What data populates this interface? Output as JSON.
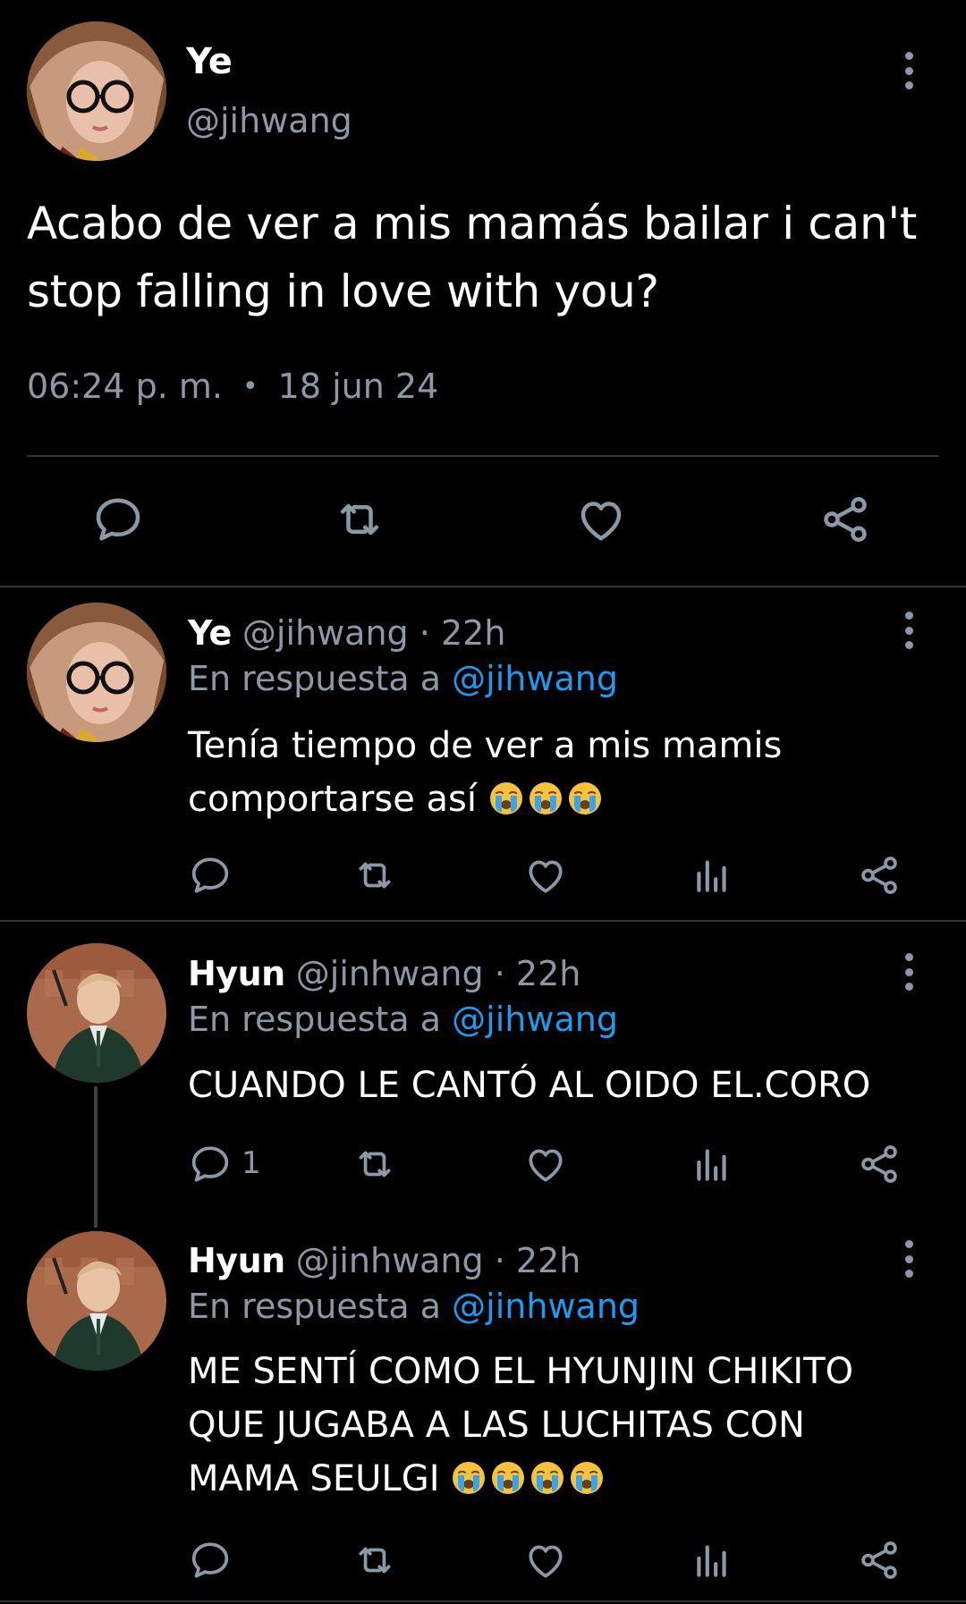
{
  "main_tweet": {
    "name": "Ye",
    "handle": "@jihwang",
    "text": "Acabo de ver a mis mamás bailar i can't stop falling in love with you?",
    "time": "06:24 p. m.",
    "separator": "•",
    "date": "18 jun 24"
  },
  "replies": [
    {
      "name": "Ye",
      "handle": "@jihwang",
      "dot": "·",
      "age": "22h",
      "replying_prefix": "En respuesta a",
      "replying_to": "@jihwang",
      "text": "Tenía tiempo de ver a mis mamis comportarse así",
      "emoji_count": 3,
      "reply_count": ""
    },
    {
      "name": "Hyun",
      "handle": "@jinhwang",
      "dot": "·",
      "age": "22h",
      "replying_prefix": "En respuesta a",
      "replying_to": "@jihwang",
      "text": "CUANDO LE CANTÓ AL OIDO EL.CORO",
      "emoji_count": 0,
      "reply_count": "1"
    },
    {
      "name": "Hyun",
      "handle": "@jinhwang",
      "dot": "·",
      "age": "22h",
      "replying_prefix": "En respuesta a",
      "replying_to": "@jinhwang",
      "text": "ME SENTÍ COMO EL HYUNJIN CHIKITO QUE JUGABA A LAS LUCHITAS CON MAMA SEULGI",
      "emoji_count": 4,
      "reply_count": ""
    }
  ],
  "icons": {
    "reply": "reply-icon",
    "retweet": "retweet-icon",
    "like": "heart-icon",
    "views": "views-icon",
    "share": "share-icon",
    "more": "more-vertical-icon",
    "emoji": "loudly-crying-face-emoji"
  },
  "colors": {
    "background": "#000000",
    "text": "#ffffff",
    "secondary": "#8b98a5",
    "link": "#1d9bf0",
    "divider": "#2f3336"
  }
}
